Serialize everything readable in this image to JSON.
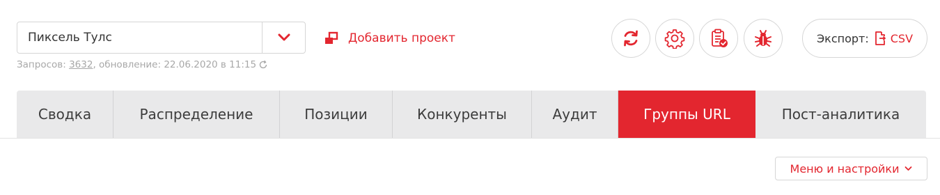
{
  "project": {
    "selected": "Пиксель Тулс",
    "add_label": "Добавить проект"
  },
  "meta": {
    "requests_prefix": "Запросов:",
    "requests_count": "3632",
    "update_text": ", обновление: 22.06.2020 в 11:15"
  },
  "actions": {
    "icons": [
      "refresh-icon",
      "settings-gear-icon",
      "clipboard-check-icon",
      "bug-icon"
    ]
  },
  "export": {
    "label": "Экспорт:",
    "format": "CSV"
  },
  "tabs": [
    {
      "label": "Сводка",
      "active": false
    },
    {
      "label": "Распределение",
      "active": false
    },
    {
      "label": "Позиции",
      "active": false
    },
    {
      "label": "Конкуренты",
      "active": false
    },
    {
      "label": "Аудит",
      "active": false
    },
    {
      "label": "Группы URL",
      "active": true
    },
    {
      "label": "Пост-аналитика",
      "active": false
    }
  ],
  "menu": {
    "label": "Меню и настройки"
  },
  "colors": {
    "accent": "#e3262f",
    "tab_bg": "#e9e9ea",
    "muted_text": "#a8a8a8",
    "border": "#d6d6d6"
  }
}
